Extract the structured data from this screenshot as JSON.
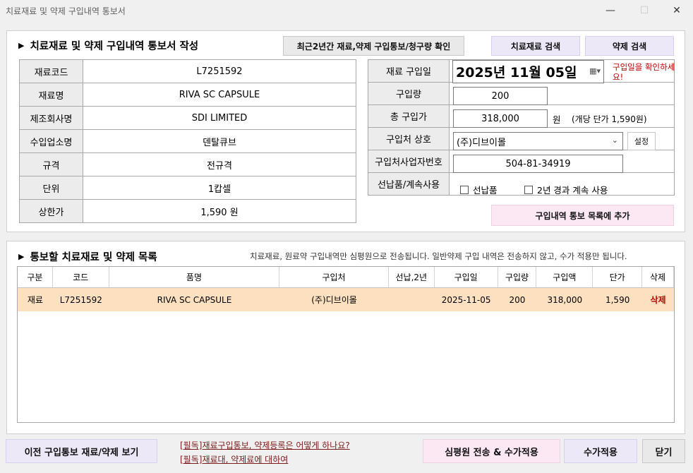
{
  "window": {
    "title": "치료재료 및 약제 구입내역 통보서"
  },
  "form": {
    "section_title": "치료재료 및 약제 구입내역 통보서 작성",
    "btn_recent": "최근2년간 재료,약제 구입통보/청구량 확인",
    "btn_material_search": "치료재료 검색",
    "btn_drug_search": "약제 검색",
    "info": [
      {
        "label": "재료코드",
        "value": "L7251592"
      },
      {
        "label": "재료명",
        "value": "RIVA SC CAPSULE"
      },
      {
        "label": "제조회사명",
        "value": "SDI LIMITED"
      },
      {
        "label": "수입업소명",
        "value": "덴탈큐브"
      },
      {
        "label": "규격",
        "value": "전규격"
      },
      {
        "label": "단위",
        "value": "1캅셀"
      },
      {
        "label": "상한가",
        "value": "1,590 원"
      }
    ],
    "purchase": {
      "date_label": "재료 구입일",
      "date_value": "2025년 11월 05일",
      "date_note": "구입일을 확인하세요!",
      "qty_label": "구입량",
      "qty_value": "200",
      "total_label": "총 구입가",
      "total_value": "318,000",
      "total_unit": "원",
      "unit_price_note": "(개당 단가 1,590원)",
      "vendor_label": "구입처 상호",
      "vendor_value": "(주)디브이몰",
      "vendor_setting": "설정",
      "bizno_label": "구입처사업자번호",
      "bizno_value": "504-81-34919",
      "prepay_label": "선납품/계속사용",
      "prepay_cb": "선납품",
      "continue_cb": "2년 경과 계속 사용"
    },
    "btn_add": "구입내역 통보 목록에 추가"
  },
  "list": {
    "section_title": "통보할 치료재료 및 약제 목록",
    "notice": "치료재료, 원료약 구입내역만 심평원으로 전송됩니다. 일반약제 구입 내역은 전송하지 않고, 수가 적용만 됩니다.",
    "headers": [
      "구분",
      "코드",
      "품명",
      "구입처",
      "선납,2년",
      "구입일",
      "구입량",
      "구입액",
      "단가",
      "삭제"
    ],
    "rows": [
      [
        "재료",
        "L7251592",
        "RIVA SC CAPSULE",
        "(주)디브이몰",
        "",
        "2025-11-05",
        "200",
        "318,000",
        "1,590",
        "삭제"
      ]
    ]
  },
  "footer": {
    "btn_prev": "이전 구입통보 재료/약제 보기",
    "link1": "[필독]재료구입통보, 약제등록은 어떻게 하나요?",
    "link2": "[필독]재료대, 약제료에 대하여",
    "btn_send": "심평원 전송 & 수가적용",
    "btn_apply": "수가적용",
    "btn_close": "닫기"
  },
  "colors": {
    "row_highlight": "#fde0c0",
    "delete_text": "#c00000",
    "lavender_button": "#ece8f8",
    "pink_button": "#fbe8f3"
  },
  "icons": [
    "calendar-icon",
    "dropdown-arrow-icon",
    "triangle-bullet-icon",
    "minimize-icon",
    "maximize-icon",
    "close-icon"
  ]
}
